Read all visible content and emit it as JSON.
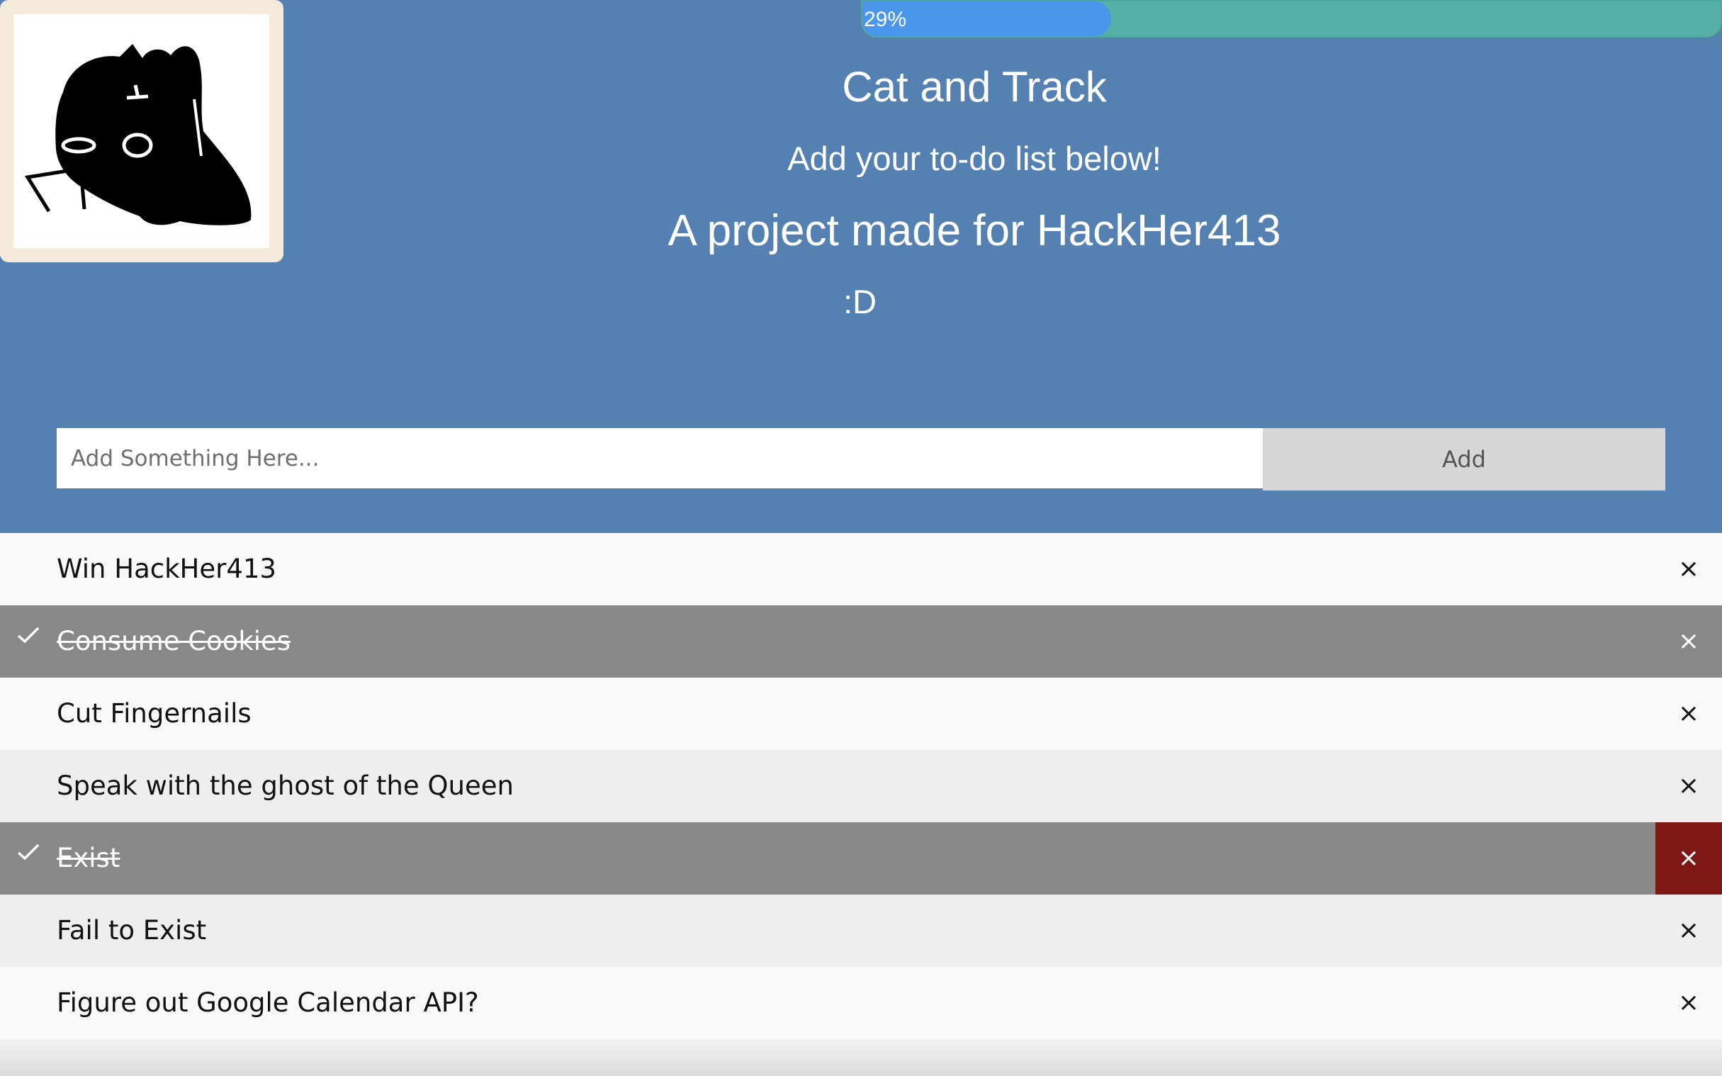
{
  "header": {
    "progress": {
      "label": "29%",
      "fraction": 0.29,
      "fill_color": "#4a96ea",
      "track_color": "#56b0a8"
    },
    "title": "Cat and Track",
    "subtitle": "Add your to-do list below!",
    "credit": "A project made for HackHer413",
    "smiley": ":D",
    "background_color": "#5581b2",
    "logo_icon": "black-cat-icon"
  },
  "input": {
    "placeholder": "Add Something Here...",
    "value": "",
    "add_label": "Add"
  },
  "todos": [
    {
      "text": "Win HackHer413",
      "checked": false,
      "close_label": "×"
    },
    {
      "text": "Consume Cookies",
      "checked": true,
      "close_label": "×"
    },
    {
      "text": "Cut Fingernails",
      "checked": false,
      "close_label": "×"
    },
    {
      "text": "Speak with the ghost of the Queen",
      "checked": false,
      "close_label": "×"
    },
    {
      "text": "Exist",
      "checked": true,
      "close_label": "×",
      "close_hovered": true
    },
    {
      "text": "Fail to Exist",
      "checked": false,
      "close_label": "×"
    },
    {
      "text": "Figure out Google Calendar API?",
      "checked": false,
      "close_label": "×"
    }
  ],
  "colors": {
    "checked_row": "#888888",
    "close_hover": "#7e1815",
    "row_odd": "#f9f9f9",
    "row_even": "#eeeeee"
  }
}
